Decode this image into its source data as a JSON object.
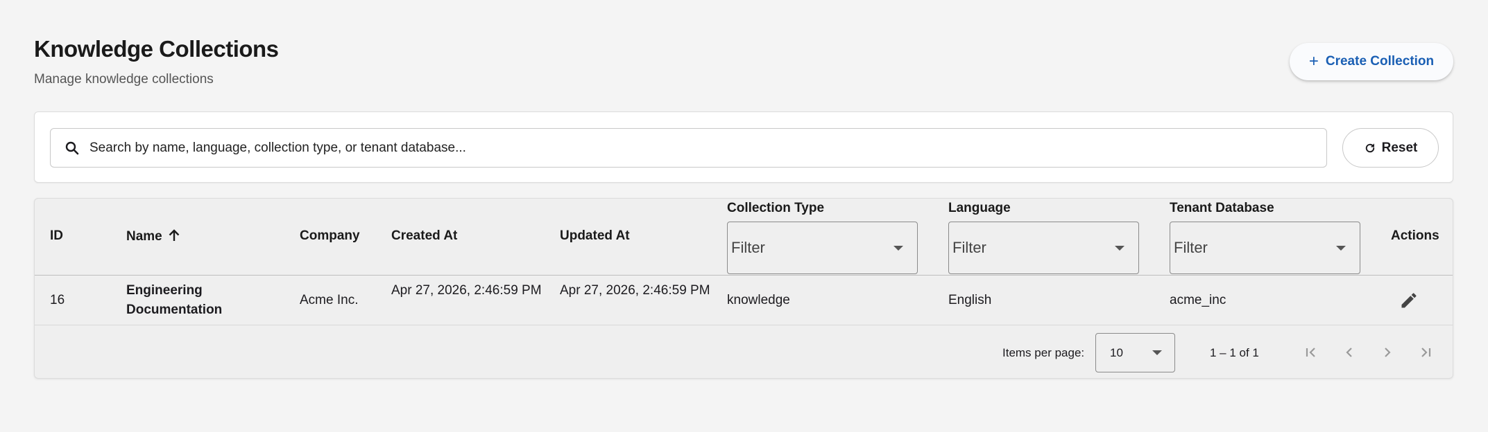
{
  "header": {
    "title": "Knowledge Collections",
    "subtitle": "Manage knowledge collections",
    "create_button_label": "Create Collection",
    "create_button_icon": "plus-icon"
  },
  "search": {
    "placeholder": "Search by name, language, collection type, or tenant database...",
    "value": "",
    "icon": "search-icon",
    "reset_label": "Reset",
    "reset_icon": "refresh-icon"
  },
  "table": {
    "columns": {
      "id": "ID",
      "name": "Name",
      "company": "Company",
      "created_at": "Created At",
      "updated_at": "Updated At",
      "collection_type": "Collection Type",
      "language": "Language",
      "tenant_database": "Tenant Database",
      "actions": "Actions"
    },
    "sort": {
      "column": "name",
      "direction": "ascending"
    },
    "filters": {
      "collection_type": "Filter",
      "language": "Filter",
      "tenant_database": "Filter"
    },
    "rows": [
      {
        "id": "16",
        "name": "Engineering Documentation",
        "company": "Acme Inc.",
        "created_at": "Apr 27, 2026, 2:46:59 PM",
        "updated_at": "Apr 27, 2026, 2:46:59 PM",
        "collection_type": "knowledge",
        "language": "English",
        "tenant_database": "acme_inc",
        "action_icon": "edit-icon"
      }
    ]
  },
  "paginator": {
    "items_per_page_label": "Items per page:",
    "items_per_page_value": "10",
    "range_label": "1 – 1 of 1"
  },
  "colors": {
    "accent": "#1a5fb4",
    "background": "#f4f4f4",
    "card": "#ffffff",
    "table_background": "#efefef"
  }
}
